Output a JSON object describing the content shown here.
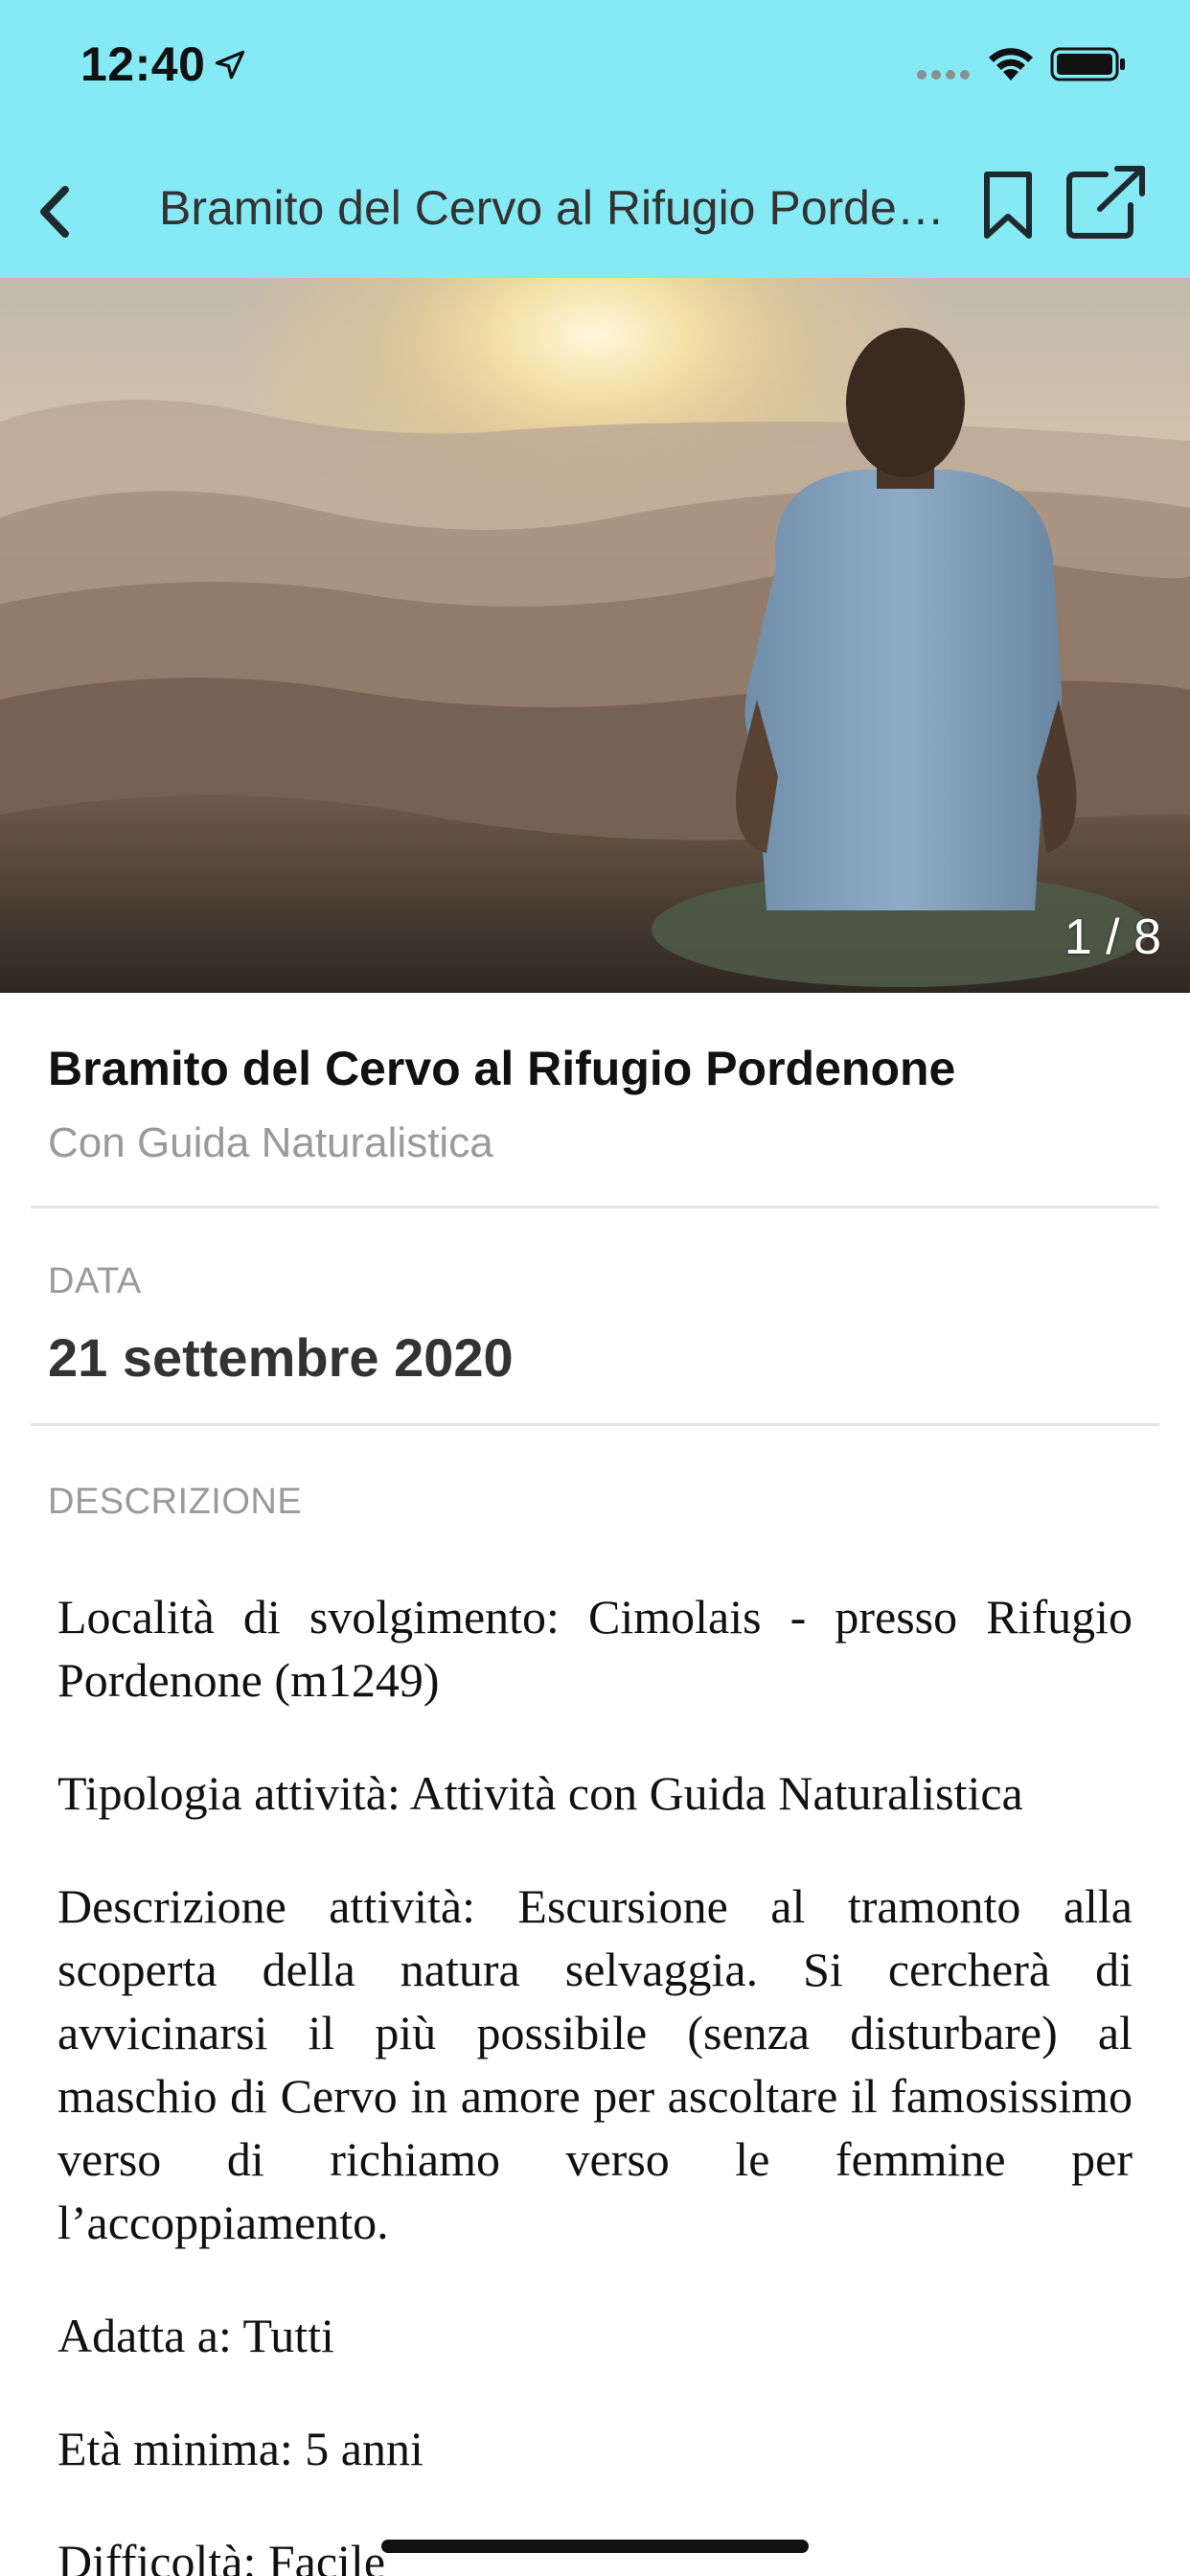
{
  "status_bar": {
    "time": "12:40"
  },
  "nav": {
    "title": "Bramito del Cervo al Rifugio Pordenone",
    "back_icon": "chevron-left-icon",
    "bookmark_icon": "bookmark-icon",
    "share_icon": "share-external-icon"
  },
  "hero": {
    "photo_counter": "1 / 8"
  },
  "event": {
    "title": "Bramito del Cervo al Rifugio Pordenone",
    "subtitle": "Con Guida Naturalistica"
  },
  "date_section": {
    "label": "DATA",
    "value": "21 settembre 2020"
  },
  "description_section": {
    "label": "DESCRIZIONE",
    "paragraphs": [
      "Località di svolgimento: Cimolais - presso Rifugio Pordenone (m1249)",
      "Tipologia attività: Attività con Guida Naturalistica",
      "Descrizione attività: Escursione al tramonto alla scoperta della natura selvaggia. Si cercherà di avvicinarsi il più possibile (senza disturbare) al maschio di Cervo in amore per ascoltare il famosissimo verso di richiamo verso le femmine per l’accoppiamento.",
      "Adatta a: Tutti",
      "Età minima: 5 anni",
      "Difficoltà: Facile"
    ]
  },
  "colors": {
    "header_background": "#86eaf5",
    "title_text": "#111111",
    "secondary_text": "#9a9a9a",
    "divider": "#e5e5e5"
  }
}
